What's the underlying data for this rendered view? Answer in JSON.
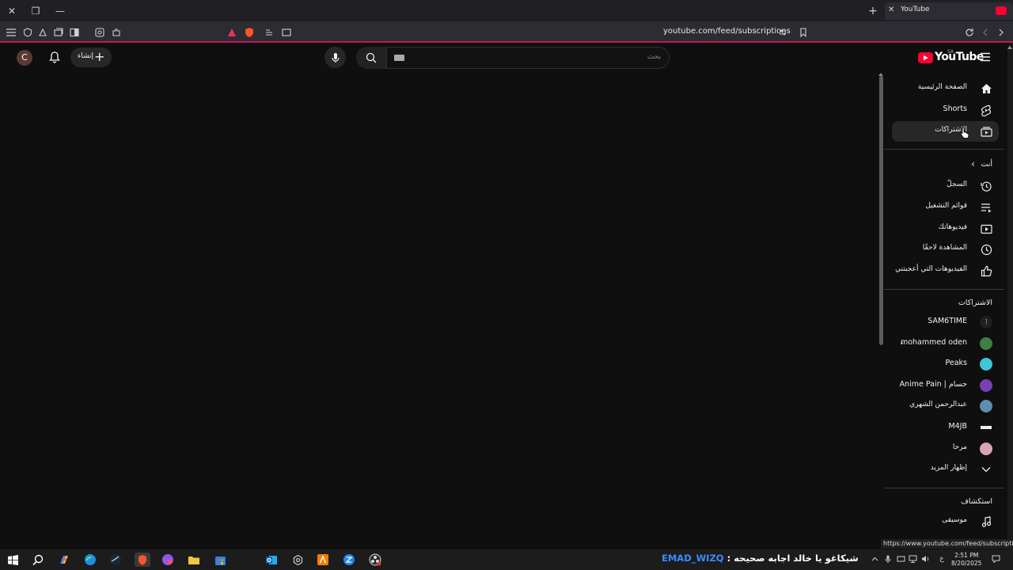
{
  "browser": {
    "tab_title": "YouTube",
    "tab_close": "✕",
    "window_close": "✕",
    "window_restore": "❐",
    "window_minimize": "—",
    "new_tab": "+",
    "url": "youtube.com/feed/subscriptions",
    "accent_color": "#c2185b"
  },
  "header": {
    "avatar_letter": "C",
    "create_label": "إنشاء",
    "create_plus": "+",
    "search_placeholder": "بحث",
    "logo_text": "YouTube",
    "logo_region": "SA"
  },
  "sidebar": {
    "main": [
      {
        "label": "الصفحة الرئيسية",
        "icon": "home-icon"
      },
      {
        "label": "Shorts",
        "icon": "shorts-icon"
      },
      {
        "label": "الاشتراكات",
        "icon": "subscriptions-icon",
        "active": true
      }
    ],
    "you_section": {
      "title": "أنت",
      "chevron": "›",
      "items": [
        {
          "label": "السجلّ",
          "icon": "history-icon"
        },
        {
          "label": "قوائم التشغيل",
          "icon": "playlists-icon"
        },
        {
          "label": "فيديوهاتك",
          "icon": "your-videos-icon"
        },
        {
          "label": "المشاهدة لاحقًا",
          "icon": "watch-later-icon"
        },
        {
          "label": "الفيديوهات التي أعجبتني",
          "icon": "liked-videos-icon"
        }
      ]
    },
    "subscriptions_section": {
      "title": "الاشتراكات",
      "channels": [
        {
          "name": "SAM6TIME",
          "color": "#1f1f1f"
        },
        {
          "name": "mohammed oden",
          "color": "#3e7f46"
        },
        {
          "name": "Peaks",
          "color": "#3fc6d8"
        },
        {
          "name": "Anime Pain | حسام",
          "color": "#7a3fb0"
        },
        {
          "name": "عبدالرحمن الشهري",
          "color": "#5a8fb0"
        },
        {
          "name": "M4JB",
          "color": "#111111"
        },
        {
          "name": "مرحا",
          "color": "#d9a5b5"
        }
      ],
      "show_more": "إظهار المزيد"
    },
    "explore_section": {
      "title": "استكشاف",
      "items": [
        {
          "label": "موسيقى",
          "icon": "music-icon"
        }
      ]
    }
  },
  "status_bar": {
    "hover_url": "https://www.youtube.com/feed/subscriptions"
  },
  "taskbar": {
    "ticker_name": "EMAD_WIZQ",
    "ticker_message": ": شيكاغو يا خالد اجابه صحيحه",
    "time": "2:51 PM",
    "date": "8/20/2025",
    "lang": "ع"
  }
}
